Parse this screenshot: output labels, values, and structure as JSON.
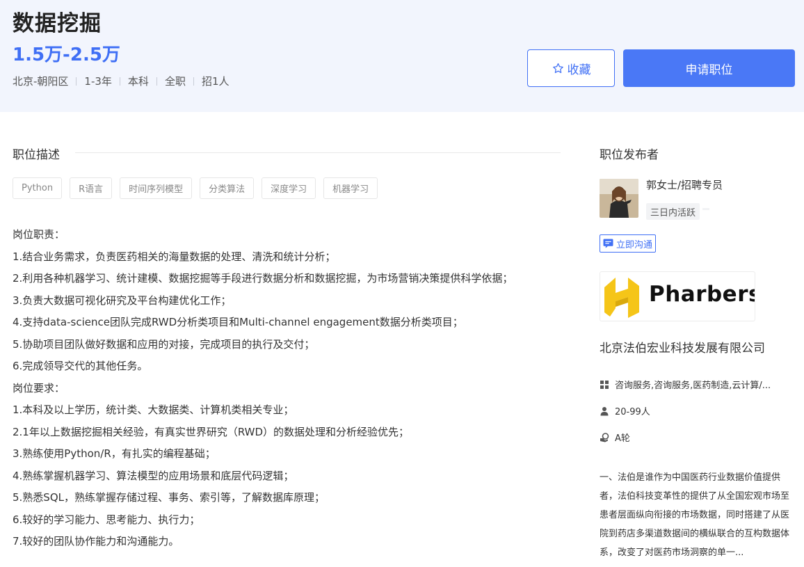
{
  "job": {
    "title": "数据挖掘",
    "salary": "1.5万-2.5万",
    "meta": [
      "北京-朝阳区",
      "1-3年",
      "本科",
      "全职",
      "招1人"
    ]
  },
  "actions": {
    "favorite_label": "收藏",
    "apply_label": "申请职位"
  },
  "description": {
    "section_title": "职位描述",
    "tags": [
      "Python",
      "R语言",
      "时间序列模型",
      "分类算法",
      "深度学习",
      "机器学习"
    ],
    "lines": [
      "岗位职责：",
      "1.结合业务需求，负责医药相关的海量数据的处理、清洗和统计分析；",
      "2.利用各种机器学习、统计建模、数据挖掘等手段进行数据分析和数据挖掘，为市场营销决策提供科学依据；",
      "3.负责大数据可视化研究及平台构建优化工作；",
      "4.支持data-science团队完成RWD分析类项目和Multi-channel engagement数据分析类项目；",
      "5.协助项目团队做好数据和应用的对接，完成项目的执行及交付；",
      "6.完成领导交代的其他任务。",
      "岗位要求：",
      "1.本科及以上学历，统计类、大数据类、计算机类相关专业；",
      "2.1年以上数据挖掘相关经验，有真实世界研究（RWD）的数据处理和分析经验优先；",
      "3.熟练使用Python/R，有扎实的编程基础；",
      "4.熟练掌握机器学习、算法模型的应用场景和底层代码逻辑；",
      "5.熟悉SQL，熟练掌握存储过程、事务、索引等，了解数据库原理；",
      "6.较好的学习能力、思考能力、执行力；",
      "7.较好的团队协作能力和沟通能力。"
    ]
  },
  "publisher": {
    "section_title": "职位发布者",
    "name": "郭女士/招聘专员",
    "active_status": "三日内活跃",
    "chat_label": "立即沟通"
  },
  "company": {
    "logo_text": "Pharbers",
    "name": "北京法伯宏业科技发展有限公司",
    "industry": "咨询服务,咨询服务,医药制造,云计算/...",
    "size": "20-99人",
    "funding": "A轮",
    "intro": "一、法伯是谁作为中国医药行业数据价值提供者，法伯科技变革性的提供了从全国宏观市场至患者层面纵向衔接的市场数据，同时搭建了从医院到药店多渠道数据间的横纵联合的互构数据体系，改变了对医药市场洞察的单一..."
  },
  "colors": {
    "accent": "#3f6ff5",
    "header_bg": "#f2f5fd",
    "logo_yellow": "#f5c518"
  }
}
